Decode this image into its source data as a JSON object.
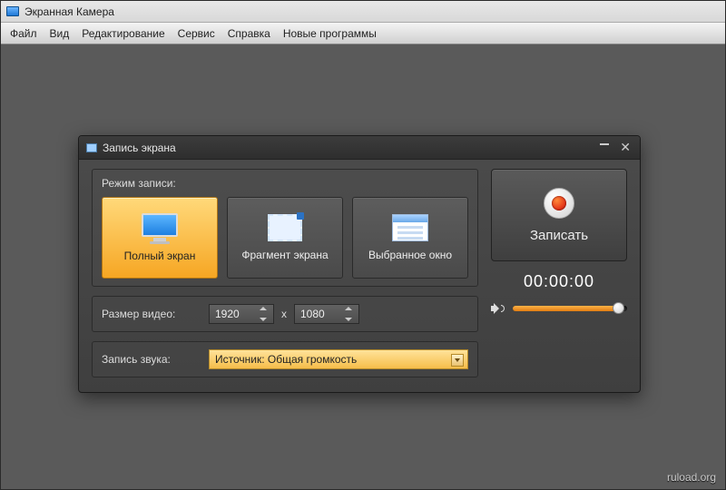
{
  "app": {
    "title": "Экранная Камера"
  },
  "menu": {
    "file": "Файл",
    "view": "Вид",
    "edit": "Редактирование",
    "service": "Сервис",
    "help": "Справка",
    "new_programs": "Новые программы"
  },
  "dialog": {
    "title": "Запись экрана",
    "mode_label": "Режим записи:",
    "modes": {
      "fullscreen": "Полный экран",
      "region": "Фрагмент экрана",
      "window": "Выбранное окно"
    },
    "size_label": "Размер видео:",
    "width": "1920",
    "height": "1080",
    "x_sep": "x",
    "audio_label": "Запись звука:",
    "audio_source": "Источник: Общая громкость"
  },
  "record": {
    "label": "Записать",
    "timer": "00:00:00",
    "volume_percent": 92
  },
  "watermark": "ruload.org"
}
